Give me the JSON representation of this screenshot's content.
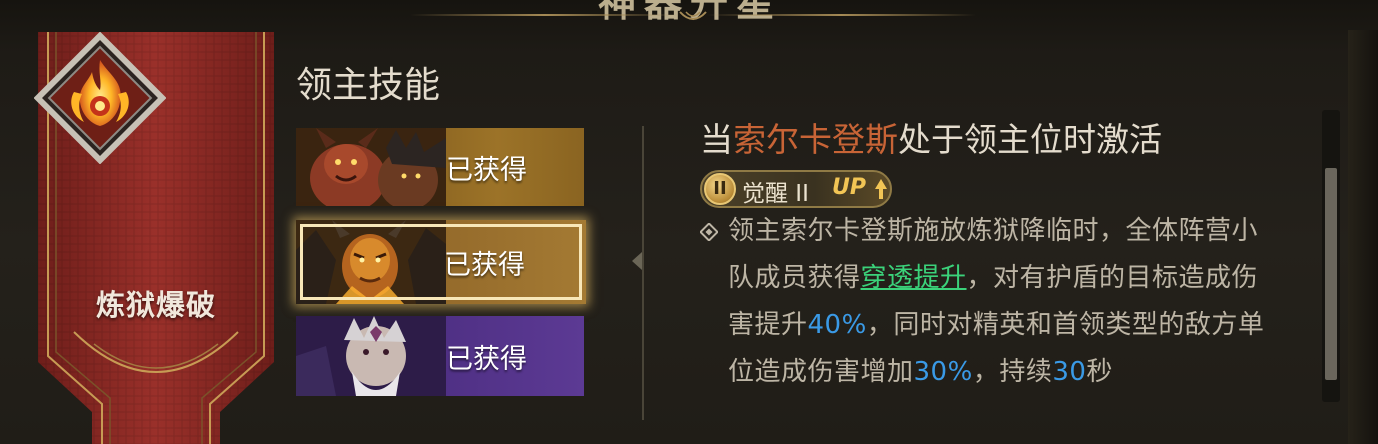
{
  "header": {
    "title": "神器升星"
  },
  "banner": {
    "skill_name": "炼狱爆破",
    "emblem_icon": "flame-emblem-icon"
  },
  "section": {
    "title": "领主技能"
  },
  "skills": [
    {
      "status": "已获得",
      "theme": "gold",
      "portrait": "red-demon-portrait"
    },
    {
      "status": "已获得",
      "theme": "gold-selected",
      "portrait": "horned-lord-portrait"
    },
    {
      "status": "已获得",
      "theme": "purple",
      "portrait": "old-warlock-portrait"
    }
  ],
  "detail": {
    "condition_prefix": "当",
    "hero_name": "索尔卡登斯",
    "condition_suffix": "处于领主位时激活",
    "awaken": {
      "badge": "II",
      "label": "觉醒 II",
      "up": "UP"
    },
    "desc": {
      "p1": "领主索尔卡登斯施放炼狱降临时，全体阵营小队成员获得",
      "link": "穿透提升",
      "p2": "，对有护盾的目标造成伤害提升",
      "v1": "40%",
      "p3": "，同时对精英和首领类型的敌方单位造成伤害增加",
      "v2": "30%",
      "p4": "，持续",
      "v3": "30",
      "p5": "秒"
    }
  },
  "colors": {
    "hero_name": "#c86436",
    "link": "#3bd27a",
    "value": "#3a9ae6",
    "banner_red": "#8f2a23"
  }
}
